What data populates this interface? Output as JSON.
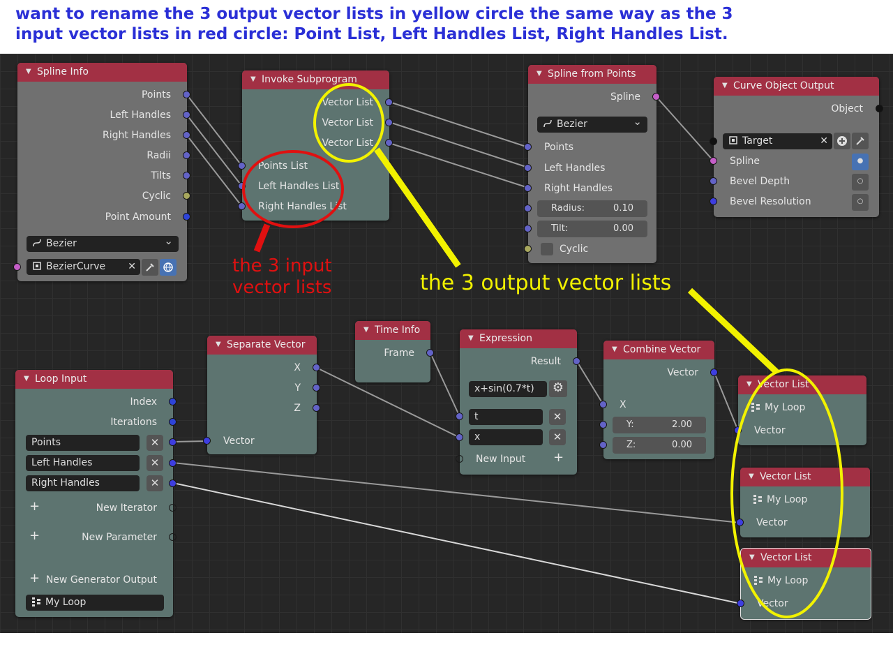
{
  "question": {
    "line1": "want to rename the 3 output vector lists in yellow circle the same way as the 3",
    "line2": "input vector lists in red circle: Point List, Left Handles List, Right Handles List."
  },
  "annotations": {
    "red_line1": "the 3 input",
    "red_line2": "vector lists",
    "yellow": "the 3 output vector lists",
    "red_color": "#e01010",
    "yellow_color": "#f2f200"
  },
  "colors": {
    "header": "#a23044",
    "node_teal": "#5d7470",
    "node_gray": "#707070",
    "canvas": "#262626",
    "vector_socket": "#6363c7",
    "object_socket": "#c55ec8"
  },
  "spline_info": {
    "title": "Spline Info",
    "outputs": [
      "Points",
      "Left Handles",
      "Right Handles",
      "Radii",
      "Tilts",
      "Cyclic",
      "Point Amount"
    ],
    "spline_type": "Bezier",
    "object": "BezierCurve"
  },
  "invoke_subprogram": {
    "title": "Invoke Subprogram",
    "outputs": [
      "Vector List",
      "Vector List",
      "Vector List"
    ],
    "inputs": [
      "Points List",
      "Left Handles List",
      "Right Handles List"
    ]
  },
  "spline_from_points": {
    "title": "Spline from Points",
    "output": "Spline",
    "spline_type": "Bezier",
    "inputs": [
      "Points",
      "Left Handles",
      "Right Handles"
    ],
    "radius_label": "Radius:",
    "radius_value": "0.10",
    "tilt_label": "Tilt:",
    "tilt_value": "0.00",
    "cyclic": "Cyclic"
  },
  "curve_object_output": {
    "title": "Curve Object Output",
    "output": "Object",
    "target": "Target",
    "inputs": [
      "Spline",
      "Bevel Depth",
      "Bevel Resolution"
    ]
  },
  "time_info": {
    "title": "Time Info",
    "output": "Frame"
  },
  "separate_vector": {
    "title": "Separate Vector",
    "outputs": [
      "X",
      "Y",
      "Z"
    ],
    "input": "Vector"
  },
  "expression": {
    "title": "Expression",
    "output": "Result",
    "expression": "x+sin(0.7*t)",
    "variables": [
      "t",
      "x"
    ],
    "new_input": "New Input"
  },
  "combine_vector": {
    "title": "Combine Vector",
    "output": "Vector",
    "x_label": "X",
    "y_label": "Y:",
    "y_value": "2.00",
    "z_label": "Z:",
    "z_value": "0.00"
  },
  "loop_input": {
    "title": "Loop Input",
    "outputs": [
      "Index",
      "Iterations"
    ],
    "iterators": [
      "Points",
      "Left Handles",
      "Right Handles"
    ],
    "new_iterator": "New Iterator",
    "new_parameter": "New Parameter",
    "new_generator_output": "New Generator Output",
    "loop_name": "My Loop"
  },
  "vector_list_nodes": [
    {
      "title": "Vector List",
      "loop": "My Loop",
      "input": "Vector"
    },
    {
      "title": "Vector List",
      "loop": "My Loop",
      "input": "Vector"
    },
    {
      "title": "Vector List",
      "loop": "My Loop",
      "input": "Vector"
    }
  ],
  "icons": [
    "bezier-icon",
    "object-icon",
    "close-icon",
    "eyedropper-icon",
    "globe-icon",
    "plus-icon",
    "gear-icon",
    "loop-icon",
    "chevron-down-icon"
  ]
}
